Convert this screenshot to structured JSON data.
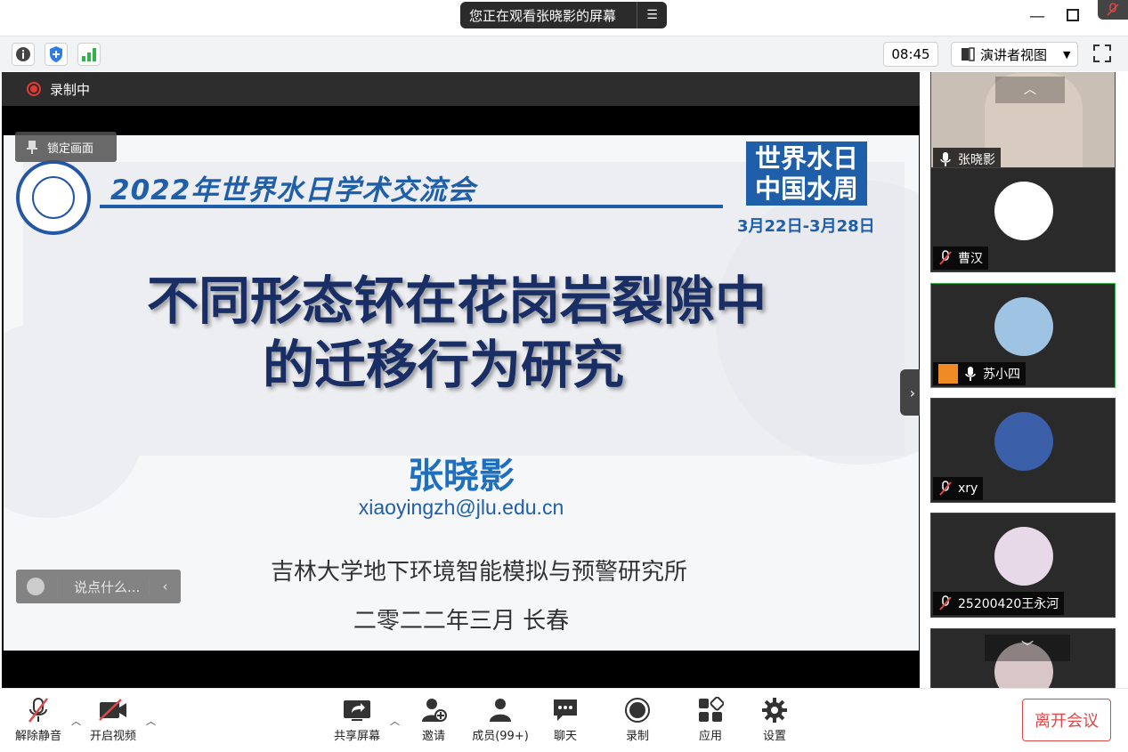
{
  "titlebar": {
    "viewing_notice": "您正在观看张晓影的屏幕",
    "minimize": "—",
    "maximize": "☐"
  },
  "infobar": {
    "time": "08:45",
    "view_mode": "演讲者视图"
  },
  "stage": {
    "recording_label": "录制中",
    "lock_label": "锁定画面",
    "chat_placeholder": "说点什么..."
  },
  "slide": {
    "conference_title": "2022年世界水日学术交流会",
    "badge_line1": "世界水日",
    "badge_line2": "中国水周",
    "dates": "3月22日-3月28日",
    "title_line1": "不同形态钚在花岗岩裂隙中",
    "title_line2": "的迁移行为研究",
    "author": "张晓影",
    "email": "xiaoyingzh@jlu.edu.cn",
    "institute": "吉林大学地下环境智能模拟与预警研究所",
    "date_city": "二零二二年三月  长春"
  },
  "gallery": {
    "participants": [
      {
        "name": "张晓影",
        "muted": false
      },
      {
        "name": "曹汉",
        "muted": true
      },
      {
        "name": "苏小四",
        "muted": false
      },
      {
        "name": "xry",
        "muted": true
      },
      {
        "name": "25200420王永河",
        "muted": true
      }
    ]
  },
  "toolbar": {
    "unmute": "解除静音",
    "start_video": "开启视频",
    "share_screen": "共享屏幕",
    "invite": "邀请",
    "members": "成员(99+)",
    "chat": "聊天",
    "record": "录制",
    "apps": "应用",
    "settings": "设置",
    "leave": "离开会议"
  },
  "colors": {
    "accent_blue": "#1f5ea8",
    "leave_red": "#e04747",
    "active_green": "#2fb34a",
    "signal_green": "#2fb34a"
  }
}
